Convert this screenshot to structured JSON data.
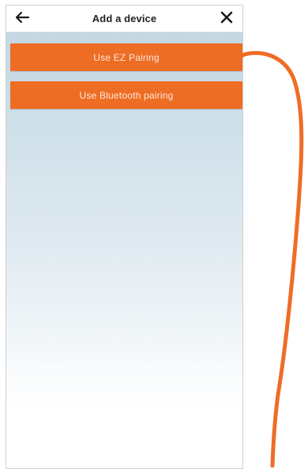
{
  "header": {
    "title": "Add a device",
    "back_icon": "back-arrow-icon",
    "close_icon": "close-icon"
  },
  "actions": {
    "ez_pairing_label": "Use EZ Pairing",
    "bluetooth_pairing_label": "Use Bluetooth pairing"
  },
  "colors": {
    "accent": "#ee6d25",
    "callout_line": "#ee6d25",
    "background_top": "#c3d8e3"
  }
}
